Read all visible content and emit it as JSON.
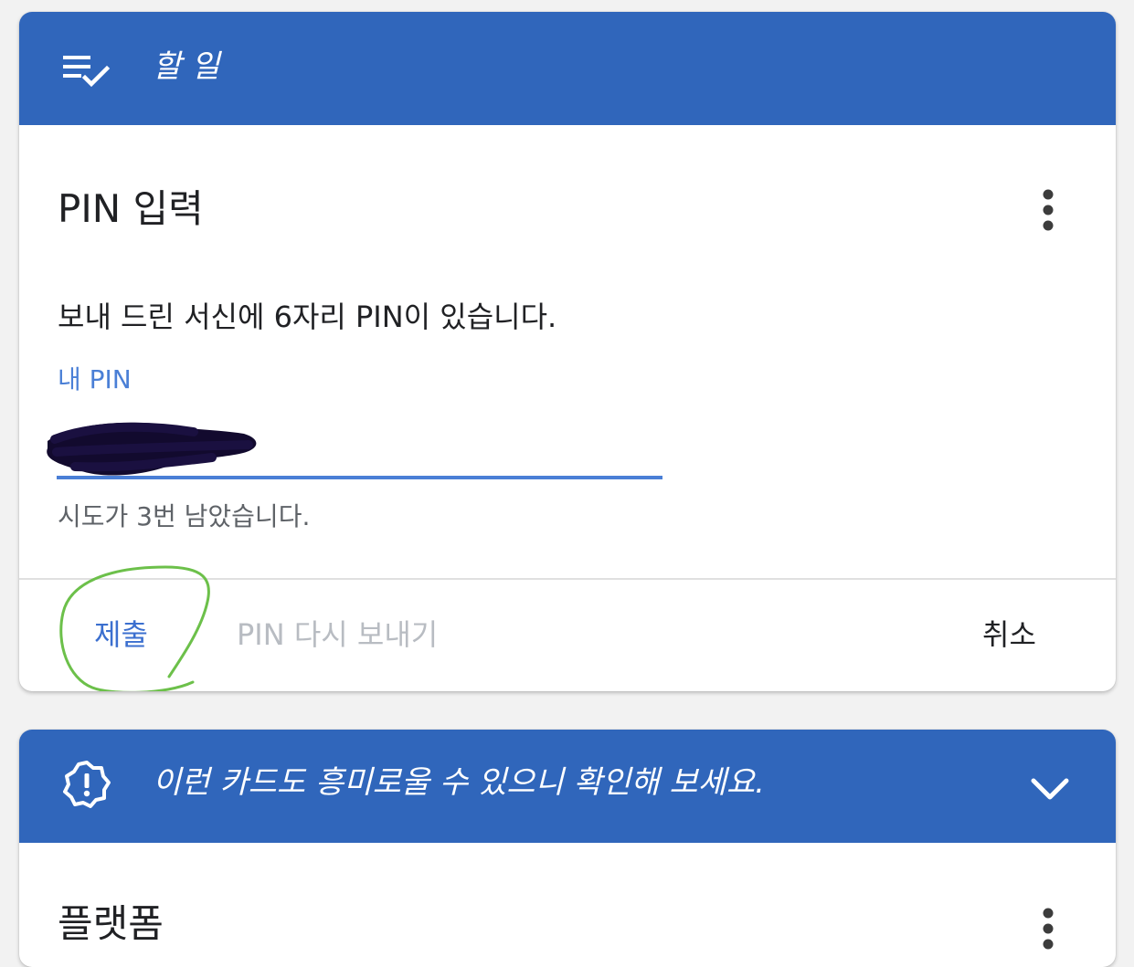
{
  "colors": {
    "header_bg": "#3066bb",
    "accent": "#4a7fd6",
    "annotation": "#6cc04a"
  },
  "todo_card": {
    "header": {
      "icon": "playlist-check-icon",
      "title": "할 일"
    },
    "title": "PIN 입력",
    "more_icon": "more-vert-icon",
    "description": "보내 드린 서신에 6자리 PIN이 있습니다.",
    "pin_field": {
      "label": "내 PIN",
      "value": "",
      "redacted": true
    },
    "helper": "시도가 3번 남았습니다.",
    "actions": {
      "submit": "제출",
      "resend": "PIN 다시 보내기",
      "cancel": "취소"
    }
  },
  "suggestion_card": {
    "header": {
      "icon": "alert-badge-icon",
      "title": "이런 카드도 흥미로울 수 있으니 확인해 보세요.",
      "toggle_icon": "chevron-down-icon"
    },
    "title": "플랫폼",
    "more_icon": "more-vert-icon"
  }
}
